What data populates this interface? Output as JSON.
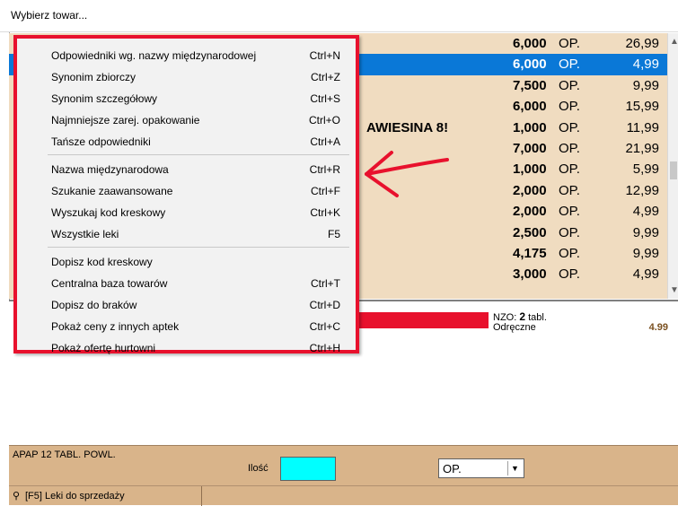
{
  "window": {
    "title": "Wybierz towar..."
  },
  "grid": {
    "rows": [
      {
        "name": "",
        "qty": "6,000",
        "unit": "OP.",
        "price": "26,99",
        "selected": false
      },
      {
        "name": "",
        "qty": "6,000",
        "unit": "OP.",
        "price": "4,99",
        "selected": true
      },
      {
        "name": "",
        "qty": "7,500",
        "unit": "OP.",
        "price": "9,99",
        "selected": false
      },
      {
        "name": "",
        "qty": "6,000",
        "unit": "OP.",
        "price": "15,99",
        "selected": false
      },
      {
        "name": "AWIESINA 8!",
        "qty": "1,000",
        "unit": "OP.",
        "price": "11,99",
        "selected": false
      },
      {
        "name": "",
        "qty": "7,000",
        "unit": "OP.",
        "price": "21,99",
        "selected": false
      },
      {
        "name": "",
        "qty": "1,000",
        "unit": "OP.",
        "price": "5,99",
        "selected": false
      },
      {
        "name": "",
        "qty": "2,000",
        "unit": "OP.",
        "price": "12,99",
        "selected": false
      },
      {
        "name": "",
        "qty": "2,000",
        "unit": "OP.",
        "price": "4,99",
        "selected": false
      },
      {
        "name": "",
        "qty": "2,500",
        "unit": "OP.",
        "price": "9,99",
        "selected": false
      },
      {
        "name": "",
        "qty": "4,175",
        "unit": "OP.",
        "price": "9,99",
        "selected": false
      },
      {
        "name": "",
        "qty": "3,000",
        "unit": "OP.",
        "price": "4,99",
        "selected": false
      }
    ]
  },
  "details": {
    "nzo_label": "NZO:",
    "nzo_value": "2",
    "nzo_unit": "tabl.",
    "odreczne": "Odręczne",
    "price": "4.99"
  },
  "bottom": {
    "product": "APAP 12 TABL. POWL.",
    "qty_label": "Ilość",
    "qty_value": "",
    "unit_value": "OP."
  },
  "status": {
    "text": "[F5] Leki do sprzedaży"
  },
  "menu": {
    "items": [
      {
        "label": "Odpowiedniki wg. nazwy międzynarodowej",
        "shortcut": "Ctrl+N"
      },
      {
        "label": "Synonim zbiorczy",
        "shortcut": "Ctrl+Z"
      },
      {
        "label": "Synonim szczegółowy",
        "shortcut": "Ctrl+S"
      },
      {
        "label": "Najmniejsze zarej. opakowanie",
        "shortcut": "Ctrl+O"
      },
      {
        "label": "Tańsze odpowiedniki",
        "shortcut": "Ctrl+A"
      },
      {
        "label": "Nazwa międzynarodowa",
        "shortcut": "Ctrl+R"
      },
      {
        "label": "Szukanie zaawansowane",
        "shortcut": "Ctrl+F"
      },
      {
        "label": "Wyszukaj kod kreskowy",
        "shortcut": "Ctrl+K"
      },
      {
        "label": "Wszystkie leki",
        "shortcut": "F5"
      },
      {
        "label": "Dopisz kod kreskowy",
        "shortcut": ""
      },
      {
        "label": "Centralna baza towarów",
        "shortcut": "Ctrl+T"
      },
      {
        "label": "Dopisz do braków",
        "shortcut": "Ctrl+D"
      },
      {
        "label": "Pokaż ceny z innych aptek",
        "shortcut": "Ctrl+C"
      },
      {
        "label": "Pokaż ofertę hurtowni",
        "shortcut": "Ctrl+H"
      }
    ]
  },
  "colors": {
    "highlight": "#e8112d",
    "selection": "#0a78d7",
    "panel": "#d9b48a",
    "grid": "#f0dcc0",
    "qty_input": "#00ffff"
  }
}
